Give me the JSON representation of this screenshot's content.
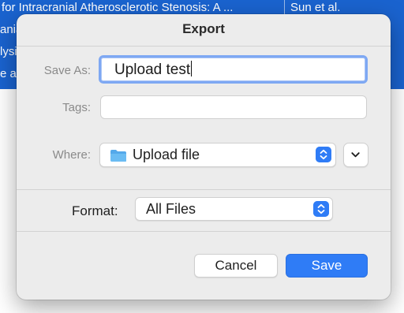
{
  "background": {
    "title_fragments": [
      "for Intracranial Atherosclerotic Stenosis: A ...",
      "anial",
      "lysis",
      "e a"
    ],
    "author_fragment": "Sun et al."
  },
  "dialog": {
    "title": "Export",
    "save_as": {
      "label": "Save As:",
      "value": "Upload test"
    },
    "tags": {
      "label": "Tags:",
      "value": ""
    },
    "where": {
      "label": "Where:",
      "value": "Upload file",
      "icon": "folder-icon"
    },
    "format": {
      "label": "Format:",
      "value": "All Files"
    },
    "buttons": {
      "cancel": "Cancel",
      "save": "Save"
    }
  },
  "colors": {
    "accent": "#2f7cf6",
    "background_selection": "#1a63cf",
    "sheet": "#ececec"
  }
}
